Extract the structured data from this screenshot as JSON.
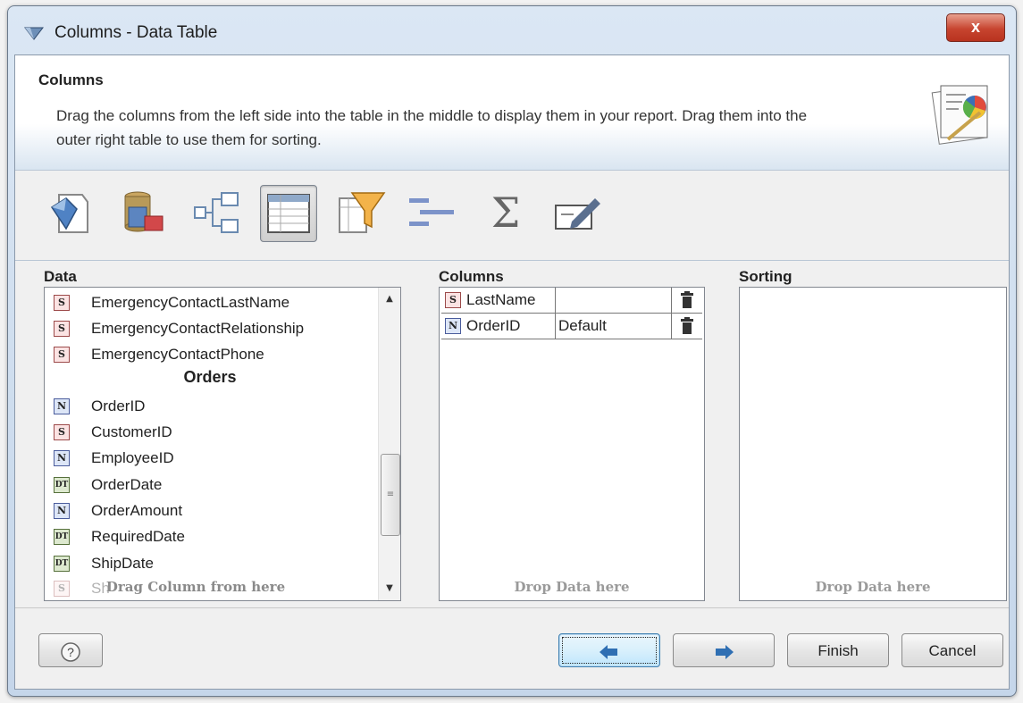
{
  "window": {
    "title": "Columns - Data Table",
    "close_label": "x"
  },
  "header": {
    "title": "Columns",
    "description": "Drag the columns from the left side into the table in the middle to display them in your report. Drag them into the outer right table to use them for sorting."
  },
  "toolbar": {
    "icons": [
      "gem-icon",
      "database-icon",
      "tree-icon",
      "table-icon",
      "filter-icon",
      "group-icon",
      "sum-icon",
      "edit-icon"
    ],
    "active": "table-icon",
    "sum_glyph": "Σ"
  },
  "data_panel": {
    "label": "Data",
    "rows_top": [
      {
        "type": "S",
        "name": "EmergencyContactLastName"
      },
      {
        "type": "S",
        "name": "EmergencyContactRelationship"
      },
      {
        "type": "S",
        "name": "EmergencyContactPhone"
      }
    ],
    "group": "Orders",
    "rows_bottom": [
      {
        "type": "N",
        "name": "OrderID"
      },
      {
        "type": "S",
        "name": "CustomerID"
      },
      {
        "type": "N",
        "name": "EmployeeID"
      },
      {
        "type": "DT",
        "name": "OrderDate"
      },
      {
        "type": "N",
        "name": "OrderAmount"
      },
      {
        "type": "DT",
        "name": "RequiredDate"
      },
      {
        "type": "DT",
        "name": "ShipDate"
      }
    ],
    "partial_row": {
      "type": "S",
      "name": "Sh"
    },
    "hint": "Drag Column from here"
  },
  "columns_panel": {
    "label": "Columns",
    "rows": [
      {
        "type": "S",
        "name": "LastName",
        "sort": ""
      },
      {
        "type": "N",
        "name": "OrderID",
        "sort": "Default"
      }
    ],
    "hint": "Drop Data here"
  },
  "sorting_panel": {
    "label": "Sorting",
    "hint": "Drop Data here"
  },
  "footer": {
    "help_label": "?",
    "finish_label": "Finish",
    "cancel_label": "Cancel"
  }
}
